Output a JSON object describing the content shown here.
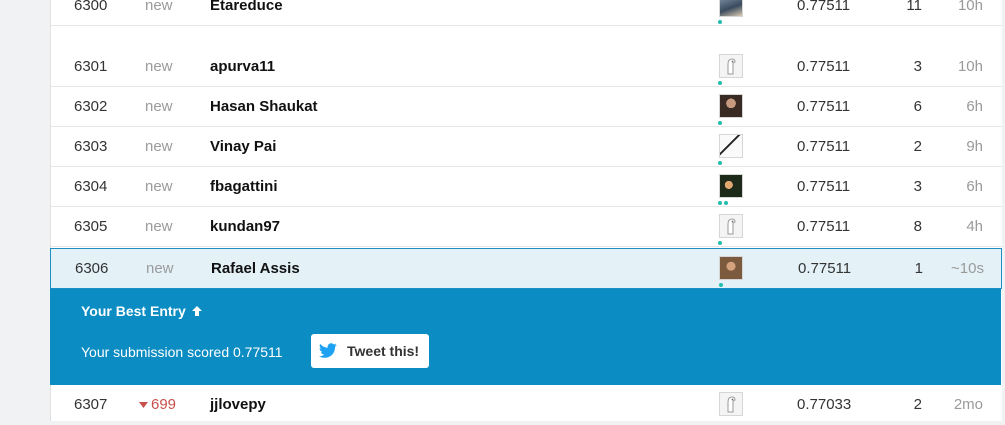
{
  "leaderboard": {
    "rows": [
      {
        "rank": "6300",
        "delta": "new",
        "name": "Etareduce",
        "score": "0.77511",
        "entries": "11",
        "last": "10h",
        "avatar": "photo-a"
      },
      {
        "rank": "6301",
        "delta": "new",
        "name": "apurva11",
        "score": "0.77511",
        "entries": "3",
        "last": "10h",
        "avatar": "kaggle"
      },
      {
        "rank": "6302",
        "delta": "new",
        "name": "Hasan Shaukat",
        "score": "0.77511",
        "entries": "6",
        "last": "6h",
        "avatar": "photo-b"
      },
      {
        "rank": "6303",
        "delta": "new",
        "name": "Vinay Pai",
        "score": "0.77511",
        "entries": "2",
        "last": "9h",
        "avatar": "photo-c"
      },
      {
        "rank": "6304",
        "delta": "new",
        "name": "fbagattini",
        "score": "0.77511",
        "entries": "3",
        "last": "6h",
        "avatar": "photo-d"
      },
      {
        "rank": "6305",
        "delta": "new",
        "name": "kundan97",
        "score": "0.77511",
        "entries": "8",
        "last": "4h",
        "avatar": "kaggle"
      },
      {
        "rank": "6306",
        "delta": "new",
        "name": "Rafael Assis",
        "score": "0.77511",
        "entries": "1",
        "last": "~10s",
        "avatar": "photo-e"
      },
      {
        "rank": "6307",
        "delta": "699",
        "name": "jjlovepy",
        "score": "0.77033",
        "entries": "2",
        "last": "2mo",
        "avatar": "kaggle"
      }
    ]
  },
  "best_entry": {
    "title": "Your Best Entry",
    "message": "Your submission scored 0.77511",
    "tweet_label": "Tweet this!"
  },
  "colors": {
    "banner": "#0b8cc2",
    "highlight_row": "#e4f2f8",
    "rank_drop": "#c8504c",
    "team_dot": "#20beb1"
  }
}
